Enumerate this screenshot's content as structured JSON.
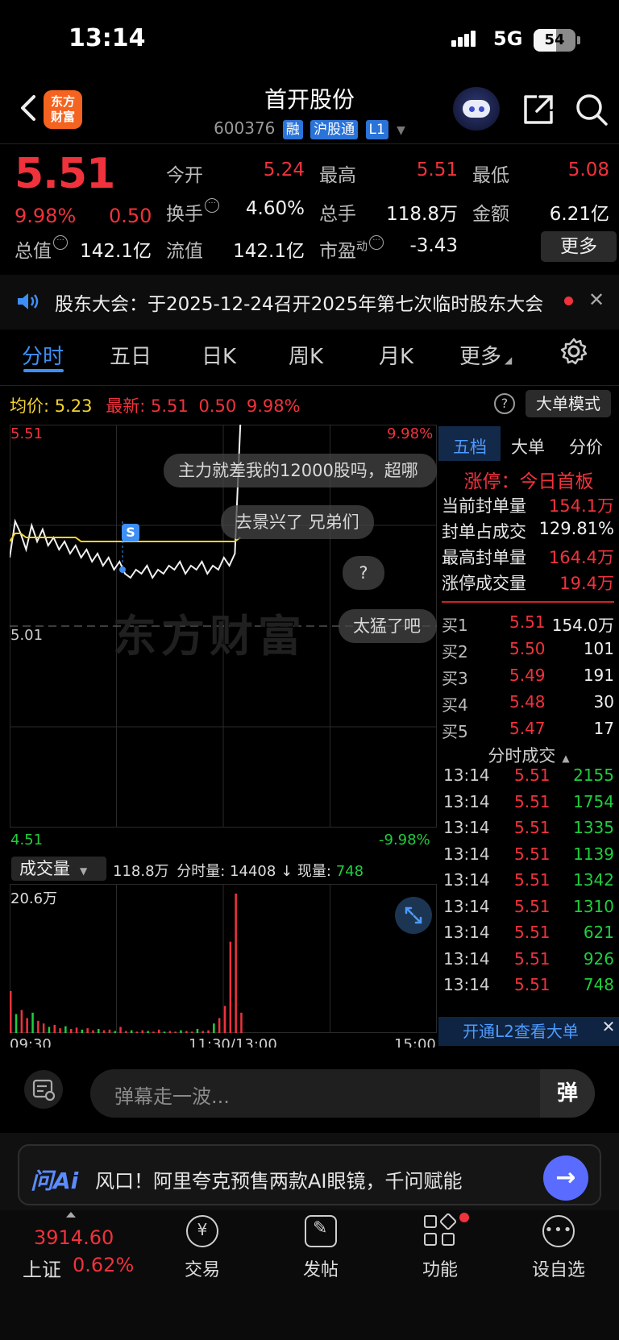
{
  "status": {
    "time": "13:14",
    "network": "5G",
    "battery": "54",
    "battery_level": 0.54
  },
  "header": {
    "logo_line1": "东方",
    "logo_line2": "财富",
    "stock_name": "首开股份",
    "stock_code": "600376",
    "tags": [
      "融",
      "沪股通",
      "L1"
    ]
  },
  "quote": {
    "last_price": "5.51",
    "change_pct": "9.98%",
    "change_abs": "0.50",
    "fields": {
      "open_label": "今开",
      "open": "5.24",
      "high_label": "最高",
      "high": "5.51",
      "low_label": "最低",
      "low": "5.08",
      "turnover_label": "换手",
      "turnover": "4.60%",
      "volume_label": "总手",
      "volume": "118.8万",
      "amount_label": "金额",
      "amount": "6.21亿",
      "mktcap_label": "总值",
      "mktcap": "142.1亿",
      "float_label": "流值",
      "float": "142.1亿",
      "pe_label": "市盈",
      "pe_sup": "动",
      "pe": "-3.43"
    },
    "more_button": "更多"
  },
  "notice": {
    "text": "股东大会：于2025-12-24召开2025年第七次临时股东大会"
  },
  "tabs": [
    "分时",
    "五日",
    "日K",
    "周K",
    "月K",
    "更多"
  ],
  "chart_header": {
    "avg_label": "均价:",
    "avg_value": "5.23",
    "latest_label": "最新:",
    "latest_value": "5.51",
    "latest_change": "0.50",
    "latest_pct": "9.98%",
    "mode_button": "大单模式"
  },
  "chart_labels": {
    "price_top": "5.51",
    "price_mid": "5.01",
    "price_bottom": "4.51",
    "pct_top": "9.98%",
    "pct_bottom": "-9.98%",
    "marker": "S",
    "watermark": "东方财富"
  },
  "danmu": [
    "主力就差我的12000股吗，超哪",
    "去景兴了  兄弟们",
    "?",
    "太猛了吧"
  ],
  "volume": {
    "selector": "成交量",
    "total": "118.8万",
    "minute_label": "分时量:",
    "minute_value": "14408",
    "current_label": "现量:",
    "current_value": "748",
    "scale_max": "20.6万",
    "times": [
      "09:30",
      "11:30/13:00",
      "15:00"
    ]
  },
  "chart_data": {
    "type": "line",
    "title": "",
    "xlabel": "",
    "ylabel": "",
    "ylim": [
      4.51,
      5.51
    ],
    "x_range": [
      "09:30",
      "15:00"
    ],
    "series": [
      {
        "name": "最新",
        "color": "#f2f2f2",
        "values": [
          5.18,
          5.27,
          5.24,
          5.2,
          5.26,
          5.22,
          5.25,
          5.21,
          5.23,
          5.2,
          5.22,
          5.19,
          5.21,
          5.18,
          5.2,
          5.17,
          5.19,
          5.16,
          5.18,
          5.15,
          5.17,
          5.14,
          5.13,
          5.15,
          5.14,
          5.16,
          5.13,
          5.15,
          5.14,
          5.16,
          5.15,
          5.17,
          5.14,
          5.16,
          5.15,
          5.17,
          5.14,
          5.16,
          5.15,
          5.18,
          5.16,
          5.19,
          5.51
        ]
      },
      {
        "name": "均价",
        "color": "#f5d430",
        "values": [
          5.22,
          5.24,
          5.24,
          5.23,
          5.23,
          5.23,
          5.23,
          5.23,
          5.23,
          5.23,
          5.23,
          5.23,
          5.23,
          5.22,
          5.22,
          5.22,
          5.22,
          5.22,
          5.22,
          5.22,
          5.22,
          5.22,
          5.22,
          5.22,
          5.22,
          5.22,
          5.22,
          5.22,
          5.22,
          5.22,
          5.22,
          5.22,
          5.22,
          5.22,
          5.22,
          5.22,
          5.22,
          5.22,
          5.22,
          5.22,
          5.22,
          5.22,
          5.23
        ]
      }
    ],
    "volume_max": 206000,
    "volume_values": [
      62000,
      28000,
      34000,
      22000,
      30000,
      18000,
      14000,
      9000,
      12000,
      7000,
      10000,
      6000,
      8000,
      5000,
      7000,
      4000,
      6000,
      4000,
      5000,
      3000,
      9000,
      3000,
      4000,
      2000,
      4000,
      3000,
      2000,
      5000,
      2000,
      3000,
      2000,
      4000,
      3000,
      2000,
      6000,
      3000,
      4000,
      14000,
      22000,
      40000,
      135000,
      206000,
      30000
    ]
  },
  "right_panel": {
    "tabs": [
      "五档",
      "大单",
      "分价"
    ],
    "limit_title": "涨停：今日首板",
    "stats": [
      {
        "label": "当前封单量",
        "value": "154.1万"
      },
      {
        "label": "封单占成交",
        "value": "129.81%"
      },
      {
        "label": "最高封单量",
        "value": "164.4万"
      },
      {
        "label": "涨停成交量",
        "value": "19.4万"
      }
    ],
    "bids": [
      {
        "label": "买1",
        "price": "5.51",
        "vol": "154.0万"
      },
      {
        "label": "买2",
        "price": "5.50",
        "vol": "101"
      },
      {
        "label": "买3",
        "price": "5.49",
        "vol": "191"
      },
      {
        "label": "买4",
        "price": "5.48",
        "vol": "30"
      },
      {
        "label": "买5",
        "price": "5.47",
        "vol": "17"
      }
    ],
    "trades_title": "分时成交",
    "trades": [
      {
        "time": "13:14",
        "price": "5.51",
        "vol": "2155"
      },
      {
        "time": "13:14",
        "price": "5.51",
        "vol": "1754"
      },
      {
        "time": "13:14",
        "price": "5.51",
        "vol": "1335"
      },
      {
        "time": "13:14",
        "price": "5.51",
        "vol": "1139"
      },
      {
        "time": "13:14",
        "price": "5.51",
        "vol": "1342"
      },
      {
        "time": "13:14",
        "price": "5.51",
        "vol": "1310"
      },
      {
        "time": "13:14",
        "price": "5.51",
        "vol": "621"
      },
      {
        "time": "13:14",
        "price": "5.51",
        "vol": "926"
      },
      {
        "time": "13:14",
        "price": "5.51",
        "vol": "748"
      }
    ],
    "l2_banner": "开通L2查看大单"
  },
  "comment": {
    "placeholder": "弹幕走一波...",
    "danmu_button": "弹"
  },
  "ai": {
    "logo": "问Ai",
    "text": "风口！阿里夸克预售两款AI眼镜，千问赋能"
  },
  "bottom_nav": {
    "index_value": "3914.60",
    "index_name": "上证",
    "index_change": "0.62%",
    "items": [
      "交易",
      "发帖",
      "功能",
      "设自选"
    ]
  },
  "colors": {
    "up": "#f0323c",
    "down": "#1fce3f",
    "accent": "#3d8ff5",
    "avg_line": "#f5d430"
  }
}
